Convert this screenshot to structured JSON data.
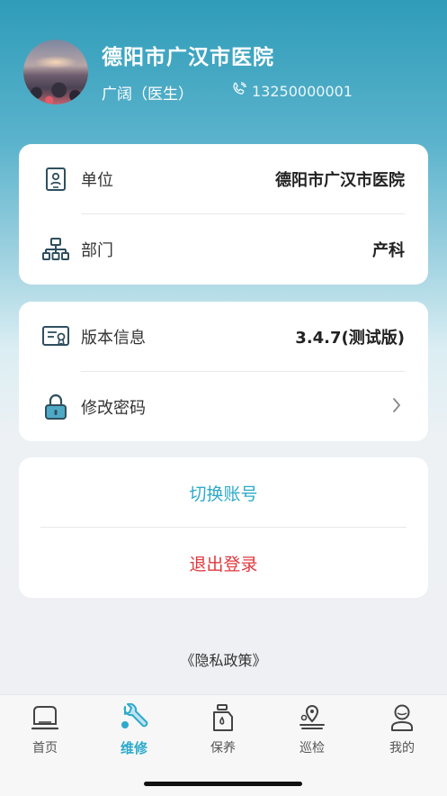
{
  "profile": {
    "hospital": "德阳市广汉市医院",
    "user": "广阔（医生）",
    "phone": "13250000001"
  },
  "info_card": {
    "rows": [
      {
        "label": "单位",
        "value": "德阳市广汉市医院",
        "icon": "id-badge-icon"
      },
      {
        "label": "部门",
        "value": "产科",
        "icon": "org-chart-icon"
      }
    ]
  },
  "settings_card": {
    "version_label": "版本信息",
    "version_value": "3.4.7(测试版)",
    "password_label": "修改密码"
  },
  "account_card": {
    "switch_label": "切换账号",
    "logout_label": "退出登录"
  },
  "privacy_label": "《隐私政策》",
  "tabs": [
    {
      "label": "首页",
      "icon": "home-icon",
      "active": false
    },
    {
      "label": "维修",
      "icon": "wrench-icon",
      "active": true
    },
    {
      "label": "保养",
      "icon": "oil-can-icon",
      "active": false
    },
    {
      "label": "巡检",
      "icon": "map-pin-icon",
      "active": false
    },
    {
      "label": "我的",
      "icon": "user-icon",
      "active": false
    }
  ],
  "colors": {
    "accent": "#2eaacb",
    "danger": "#e0383e",
    "icon": "#2f4f5f"
  }
}
